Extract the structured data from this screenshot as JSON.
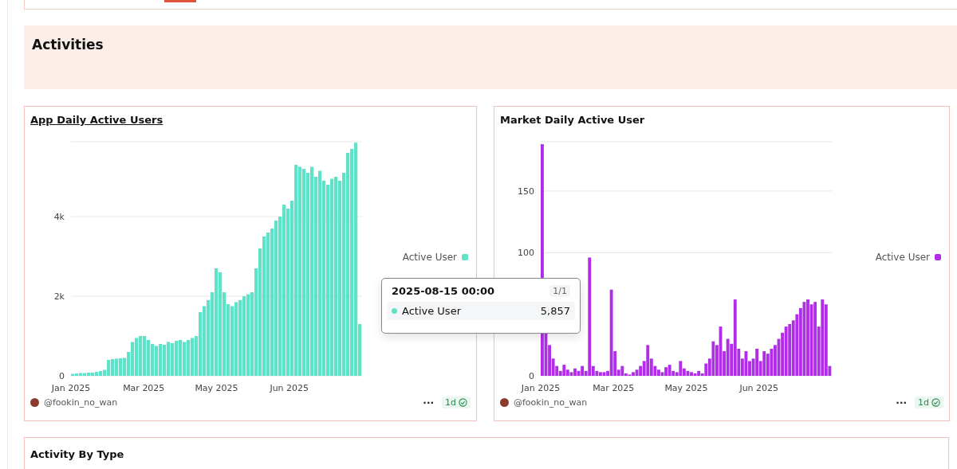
{
  "section": {
    "title": "Activities"
  },
  "charts": [
    {
      "title": "App Daily Active Users",
      "link": true,
      "author": "@fookin_no_wan",
      "menu": "···",
      "freshness": "1d",
      "x_axis_labels": [
        "Jan 2025",
        "Mar 2025",
        "May 2025",
        "Jun 2025"
      ],
      "chart_data": {
        "type": "bar",
        "ylim": [
          0,
          5880
        ],
        "yticks": [
          {
            "value": 0,
            "label": "0"
          },
          {
            "value": 2000,
            "label": "2k"
          },
          {
            "value": 4000,
            "label": "4k"
          }
        ],
        "series": [
          {
            "name": "Active User",
            "color": "#5fe3c8",
            "values": [
              50,
              60,
              70,
              70,
              80,
              80,
              100,
              120,
              150,
              400,
              420,
              430,
              440,
              450,
              600,
              850,
              950,
              1000,
              1000,
              900,
              800,
              750,
              800,
              780,
              850,
              820,
              880,
              900,
              850,
              900,
              950,
              1000,
              1600,
              1750,
              1900,
              2100,
              2700,
              2600,
              2100,
              1800,
              1750,
              1850,
              1900,
              2000,
              2050,
              2100,
              2700,
              3200,
              3500,
              3600,
              3700,
              3900,
              4000,
              4300,
              4200,
              4400,
              5300,
              5250,
              5200,
              5100,
              5250,
              5000,
              5150,
              4900,
              4800,
              4950,
              5000,
              4900,
              5100,
              5600,
              5700,
              5857,
              1300
            ]
          }
        ]
      }
    },
    {
      "title": "Market Daily Active User",
      "link": false,
      "author": "@fookin_no_wan",
      "menu": "···",
      "freshness": "1d",
      "x_axis_labels": [
        "Jan 2025",
        "Mar 2025",
        "May 2025",
        "Jun 2025"
      ],
      "chart_data": {
        "type": "bar",
        "ylim": [
          0,
          190
        ],
        "yticks": [
          {
            "value": 0,
            "label": "0"
          },
          {
            "value": 100,
            "label": "100"
          },
          {
            "value": 150,
            "label": "150"
          }
        ],
        "series": [
          {
            "name": "Active User",
            "color": "#b12ee8",
            "values": [
              188,
              35,
              25,
              14,
              8,
              4,
              9,
              5,
              3,
              6,
              4,
              8,
              4,
              96,
              8,
              4,
              3,
              3,
              4,
              70,
              20,
              5,
              8,
              2,
              1,
              3,
              5,
              8,
              12,
              25,
              14,
              8,
              5,
              3,
              7,
              9,
              4,
              3,
              12,
              6,
              4,
              3,
              2,
              4,
              2,
              10,
              14,
              28,
              25,
              40,
              20,
              30,
              26,
              62,
              22,
              14,
              20,
              12,
              14,
              22,
              12,
              20,
              18,
              22,
              25,
              30,
              35,
              40,
              42,
              45,
              50,
              55,
              60,
              62,
              58,
              60,
              40,
              62,
              58,
              8
            ]
          }
        ]
      }
    }
  ],
  "tooltip": {
    "title": "2025-08-15 00:00",
    "page": "1/1",
    "label": "Active User",
    "value": "5,857",
    "color": "#5fe3c8"
  },
  "next_section": {
    "title": "Activity By Type"
  }
}
